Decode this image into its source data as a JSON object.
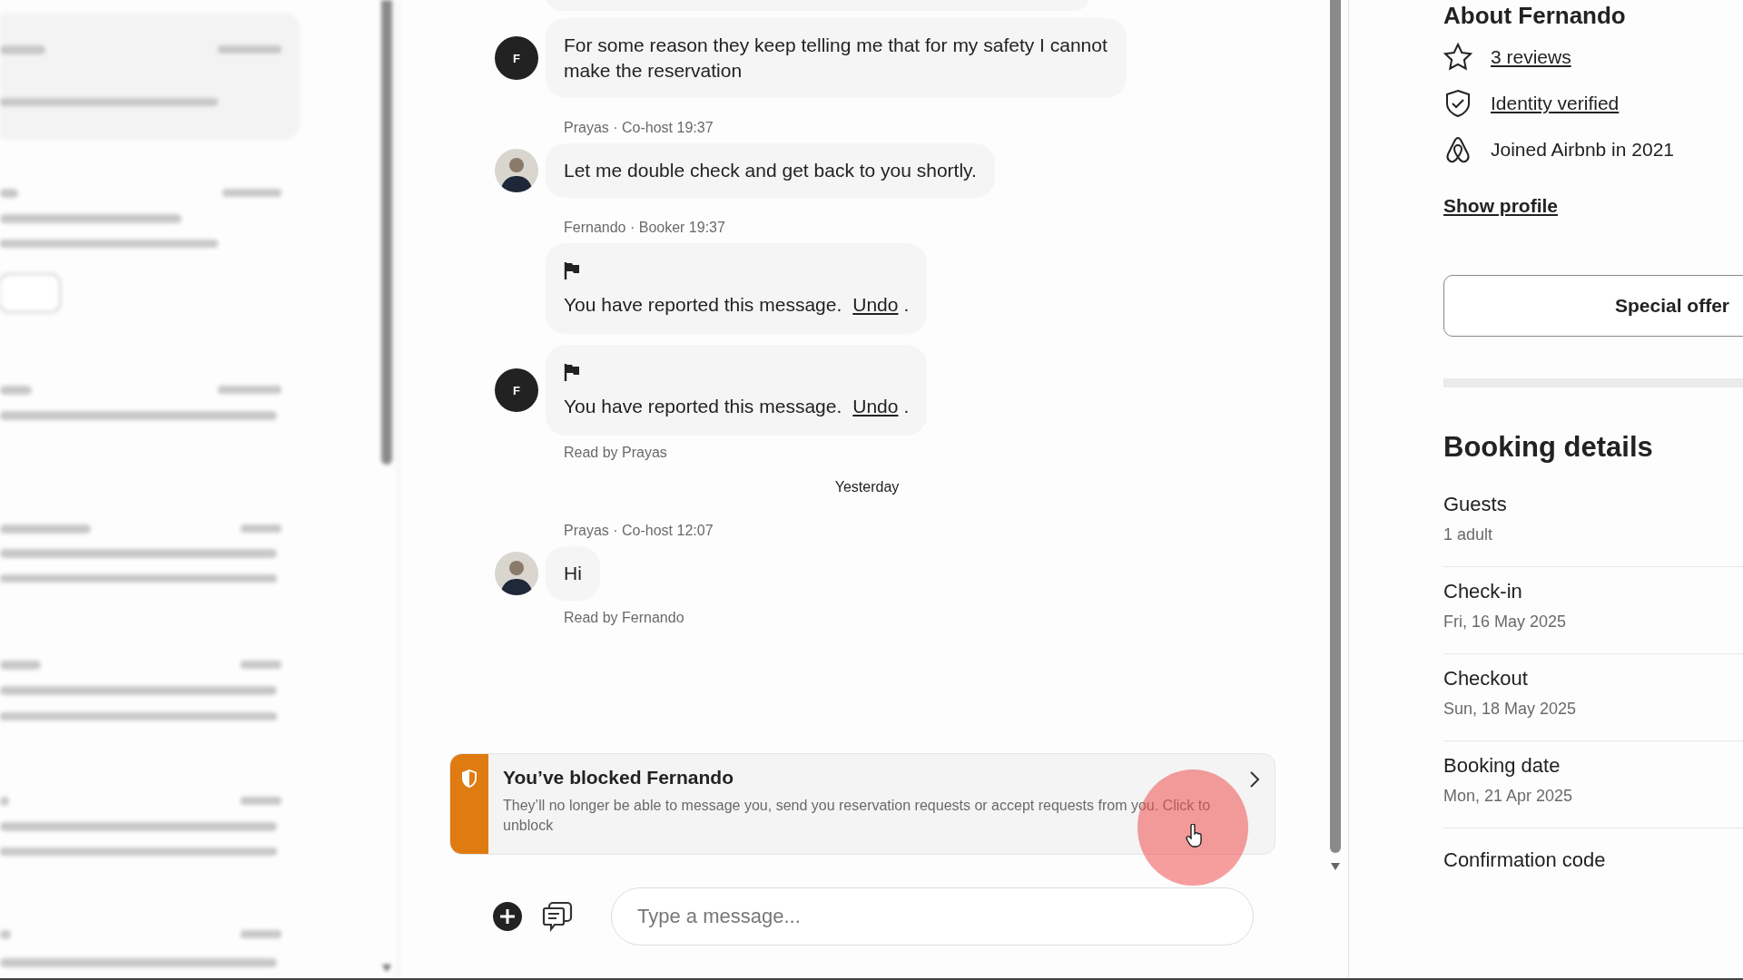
{
  "thread": [
    {
      "kind": "partial"
    },
    {
      "kind": "text",
      "avatar": {
        "kind": "initial",
        "initial": "F"
      },
      "text": "For some reason they keep telling me that for my safety I cannot make the reservation"
    },
    {
      "kind": "meta",
      "sender": "Prayas · Co-host",
      "time": "19:37"
    },
    {
      "kind": "text",
      "avatar": {
        "kind": "photo"
      },
      "text": "Let me double check and get back to you shortly."
    },
    {
      "kind": "meta",
      "sender": "Fernando · Booker",
      "time": "19:37"
    },
    {
      "kind": "reported",
      "text": "You have reported this message.",
      "link": "Undo",
      "after": "."
    },
    {
      "kind": "reported",
      "avatar": {
        "kind": "initial",
        "initial": "F"
      },
      "text": "You have reported this message.",
      "link": "Undo",
      "after": "."
    },
    {
      "kind": "receipt",
      "text": "Read by Prayas"
    },
    {
      "kind": "date",
      "text": "Yesterday"
    },
    {
      "kind": "meta",
      "sender": "Prayas · Co-host",
      "time": "12:07"
    },
    {
      "kind": "text",
      "avatar": {
        "kind": "photo"
      },
      "text": "Hi"
    },
    {
      "kind": "receipt",
      "text": "Read by Fernando"
    }
  ],
  "blocked_banner": {
    "title": "You’ve blocked Fernando",
    "body": "They’ll no longer be able to message you, send you reservation requests or accept requests from you. Click to unblock"
  },
  "composer": {
    "placeholder": "Type a message..."
  },
  "about": {
    "heading": "About Fernando",
    "facts": [
      {
        "kind": "star",
        "text": "3 reviews",
        "link": true
      },
      {
        "kind": "shield",
        "text": "Identity verified",
        "link": true
      },
      {
        "kind": "airbnb",
        "text": "Joined Airbnb in 2021",
        "link": false
      }
    ],
    "show_profile": "Show profile",
    "special_offer": "Special offer"
  },
  "booking_details": {
    "heading": "Booking details",
    "rows": [
      {
        "label": "Guests",
        "value": "1 adult"
      },
      {
        "label": "Check-in",
        "value": "Fri, 16 May 2025"
      },
      {
        "label": "Checkout",
        "value": "Sun, 18 May 2025"
      },
      {
        "label": "Booking date",
        "value": "Mon, 21 Apr 2025"
      },
      {
        "label": "Confirmation code"
      }
    ]
  }
}
